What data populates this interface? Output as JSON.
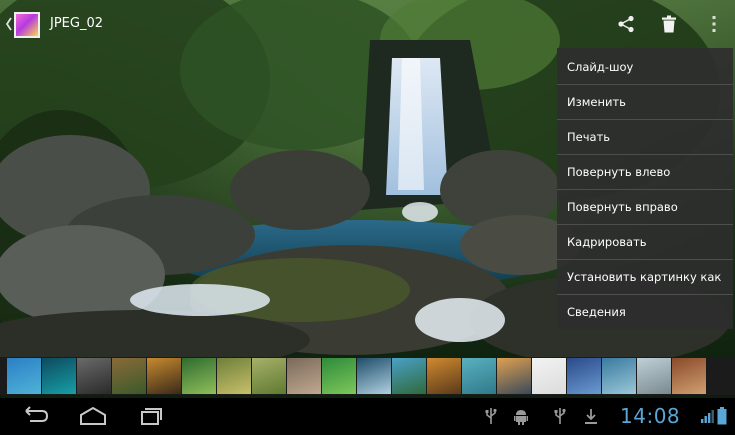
{
  "action_bar": {
    "title": "JPEG_02",
    "icons": [
      "back-caret-icon",
      "album-thumbnail-icon",
      "share-icon",
      "trash-icon",
      "overflow-menu-icon"
    ]
  },
  "menu": {
    "items": [
      {
        "label": "Слайд-шоу"
      },
      {
        "label": "Изменить"
      },
      {
        "label": "Печать"
      },
      {
        "label": "Повернуть влево"
      },
      {
        "label": "Повернуть вправо"
      },
      {
        "label": "Кадрировать"
      },
      {
        "label": "Установить картинку как"
      },
      {
        "label": "Сведения"
      }
    ]
  },
  "filmstrip": {
    "thumbnails": [
      {
        "colors": [
          "#2b7fc5",
          "#4fb3d8"
        ]
      },
      {
        "colors": [
          "#0d4a5e",
          "#17a0a8"
        ]
      },
      {
        "colors": [
          "#6a6a6a",
          "#2a2a2a"
        ]
      },
      {
        "colors": [
          "#8a6a3a",
          "#3b5a2a"
        ]
      },
      {
        "colors": [
          "#c78a2e",
          "#3a2a1a"
        ]
      },
      {
        "colors": [
          "#2f6b2f",
          "#8fbf5a"
        ]
      },
      {
        "colors": [
          "#6e7f3a",
          "#c8c06a"
        ]
      },
      {
        "colors": [
          "#a7b06a",
          "#5f7a30"
        ]
      },
      {
        "colors": [
          "#7a6a5a",
          "#c0a890"
        ]
      },
      {
        "colors": [
          "#2e8a3a",
          "#7ec85a"
        ]
      },
      {
        "colors": [
          "#1f4e6a",
          "#b0d0e0"
        ]
      },
      {
        "colors": [
          "#4aa0c8",
          "#2f6a3a"
        ]
      },
      {
        "colors": [
          "#d08a30",
          "#5a3a1a"
        ]
      },
      {
        "colors": [
          "#5ab0c0",
          "#2f7a8a"
        ]
      },
      {
        "colors": [
          "#e0a050",
          "#3a4a5a"
        ]
      },
      {
        "colors": [
          "#f2f2f2",
          "#dcdcdc"
        ]
      },
      {
        "colors": [
          "#2a4a8a",
          "#6a9ad0"
        ]
      },
      {
        "colors": [
          "#3a7aa0",
          "#9ac8d8"
        ]
      },
      {
        "colors": [
          "#c0d0d8",
          "#7a8a90"
        ]
      },
      {
        "colors": [
          "#8a4a2a",
          "#d0a070"
        ]
      },
      {
        "colors": [
          "#d8d8d8",
          "#8a8a8a"
        ]
      }
    ]
  },
  "system_bar": {
    "nav": [
      "back-nav-icon",
      "home-nav-icon",
      "recent-apps-icon"
    ],
    "status_icons": [
      "usb-icon",
      "android-debug-icon",
      "usb-icon",
      "download-icon"
    ],
    "clock": "14:08",
    "signal_icon": "signal-icon",
    "battery_icon": "battery-icon",
    "accent_color": "#5aa6d6"
  }
}
